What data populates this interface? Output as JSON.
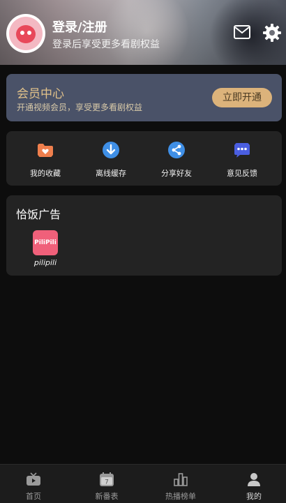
{
  "header": {
    "login_title": "登录/注册",
    "login_subtitle": "登录后享受更多看剧权益"
  },
  "vip": {
    "title": "会员中心",
    "subtitle": "开通视频会员，享受更多看剧权益",
    "button": "立即开通",
    "accent_color": "#dcb37b"
  },
  "quick_actions": [
    {
      "label": "我的收藏",
      "icon": "favorite-folder-icon",
      "color": "#ef7f4d"
    },
    {
      "label": "离线缓存",
      "icon": "download-icon",
      "color": "#3f8fe6"
    },
    {
      "label": "分享好友",
      "icon": "share-icon",
      "color": "#3f8fe6"
    },
    {
      "label": "意见反馈",
      "icon": "feedback-icon",
      "color": "#4a5ee0"
    }
  ],
  "ads": {
    "title": "恰饭广告",
    "apps": [
      {
        "label": "pilipili",
        "icon_text": "PiliPili"
      }
    ]
  },
  "tabbar": [
    {
      "label": "首页",
      "icon": "home-tv-icon"
    },
    {
      "label": "新番表",
      "icon": "calendar-icon",
      "badge": "7"
    },
    {
      "label": "热播榜单",
      "icon": "chart-icon"
    },
    {
      "label": "我的",
      "icon": "profile-icon"
    }
  ]
}
